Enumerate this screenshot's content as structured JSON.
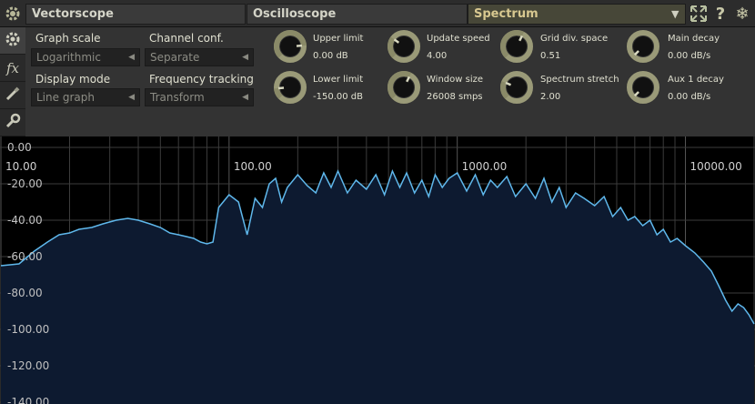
{
  "tabs": [
    {
      "label": "Vectorscope",
      "active": false
    },
    {
      "label": "Oscilloscope",
      "active": false
    },
    {
      "label": "Spectrum",
      "active": true
    }
  ],
  "toolbar_icons": [
    "settings-gear-icon",
    "dropdown-arrow-icon",
    "fullscreen-icon",
    "help-icon",
    "snowflake-icon"
  ],
  "sidebar": [
    {
      "icon": "gear-icon",
      "active": true
    },
    {
      "icon": "fx-icon",
      "label": "fx",
      "active": false
    },
    {
      "icon": "brush-icon",
      "active": false
    },
    {
      "icon": "wrench-icon",
      "active": false
    }
  ],
  "controls": {
    "graph_scale": {
      "label": "Graph scale",
      "value": "Logarithmic"
    },
    "channel_conf": {
      "label": "Channel conf.",
      "value": "Separate"
    },
    "display_mode": {
      "label": "Display mode",
      "value": "Line graph"
    },
    "frequency_tracking": {
      "label": "Frequency tracking",
      "value": "Transform"
    }
  },
  "knobs": [
    {
      "name": "upper-limit",
      "label": "Upper limit",
      "value": "0.00 dB",
      "level": 0.82
    },
    {
      "name": "lower-limit",
      "label": "Lower limit",
      "value": "-150.00 dB",
      "level": 0.15
    },
    {
      "name": "update-speed",
      "label": "Update speed",
      "value": "4.00",
      "level": 0.3
    },
    {
      "name": "window-size",
      "label": "Window size",
      "value": "26008 smps",
      "level": 0.6
    },
    {
      "name": "grid-div-space",
      "label": "Grid div. space",
      "value": "0.51",
      "level": 0.6
    },
    {
      "name": "spectrum-stretch",
      "label": "Spectrum stretch",
      "value": "2.00",
      "level": 0.25
    },
    {
      "name": "main-decay",
      "label": "Main decay",
      "value": "0.00 dB/s",
      "level": 0.0
    },
    {
      "name": "aux-1-decay",
      "label": "Aux 1 decay",
      "value": "0.00 dB/s",
      "level": 0.0
    }
  ],
  "graph": {
    "y_labels": [
      "0.00",
      "-20.00",
      "-40.00",
      "-60.00",
      "-80.00",
      "-100.00",
      "-120.00",
      "-140.00"
    ],
    "x_labels": [
      "10.00",
      "100.00",
      "1000.00",
      "10000.00"
    ],
    "colors": {
      "line": "#5fb8ec",
      "fill": "#0d1a30",
      "grid": "#3c3c3c",
      "background": "#000000"
    }
  },
  "chart_data": {
    "type": "area",
    "x_scale": "log",
    "xlim": [
      10,
      20000
    ],
    "ylim": [
      -140,
      0
    ],
    "x": [
      10,
      12,
      14,
      16,
      18,
      20,
      22,
      25,
      28,
      32,
      36,
      40,
      45,
      50,
      55,
      60,
      65,
      70,
      75,
      80,
      85,
      90,
      100,
      110,
      120,
      130,
      140,
      150,
      160,
      170,
      180,
      200,
      220,
      240,
      260,
      280,
      300,
      330,
      360,
      400,
      440,
      480,
      520,
      560,
      600,
      650,
      700,
      750,
      800,
      860,
      920,
      1000,
      1100,
      1200,
      1300,
      1400,
      1500,
      1650,
      1800,
      2000,
      2200,
      2400,
      2600,
      2800,
      3000,
      3300,
      3600,
      4000,
      4400,
      4800,
      5200,
      5600,
      6000,
      6500,
      7000,
      7500,
      8000,
      8600,
      9200,
      10000,
      11000,
      12000,
      13000,
      14000,
      15000,
      16000,
      17000,
      18000,
      19000,
      20000
    ],
    "y": [
      -65,
      -64,
      -57,
      -52,
      -48,
      -47,
      -45,
      -44,
      -42,
      -40,
      -39,
      -40,
      -42,
      -44,
      -47,
      -48,
      -49,
      -50,
      -52,
      -53,
      -52,
      -33,
      -26,
      -30,
      -48,
      -28,
      -33,
      -20,
      -17,
      -30,
      -22,
      -15,
      -21,
      -25,
      -14,
      -22,
      -13,
      -25,
      -18,
      -23,
      -15,
      -26,
      -13,
      -22,
      -14,
      -25,
      -18,
      -27,
      -15,
      -22,
      -17,
      -14,
      -24,
      -15,
      -26,
      -18,
      -22,
      -16,
      -27,
      -20,
      -28,
      -17,
      -30,
      -22,
      -33,
      -25,
      -28,
      -32,
      -27,
      -38,
      -33,
      -40,
      -38,
      -43,
      -40,
      -48,
      -45,
      -52,
      -50,
      -54,
      -58,
      -63,
      -68,
      -76,
      -84,
      -90,
      -86,
      -88,
      -92,
      -97
    ]
  }
}
